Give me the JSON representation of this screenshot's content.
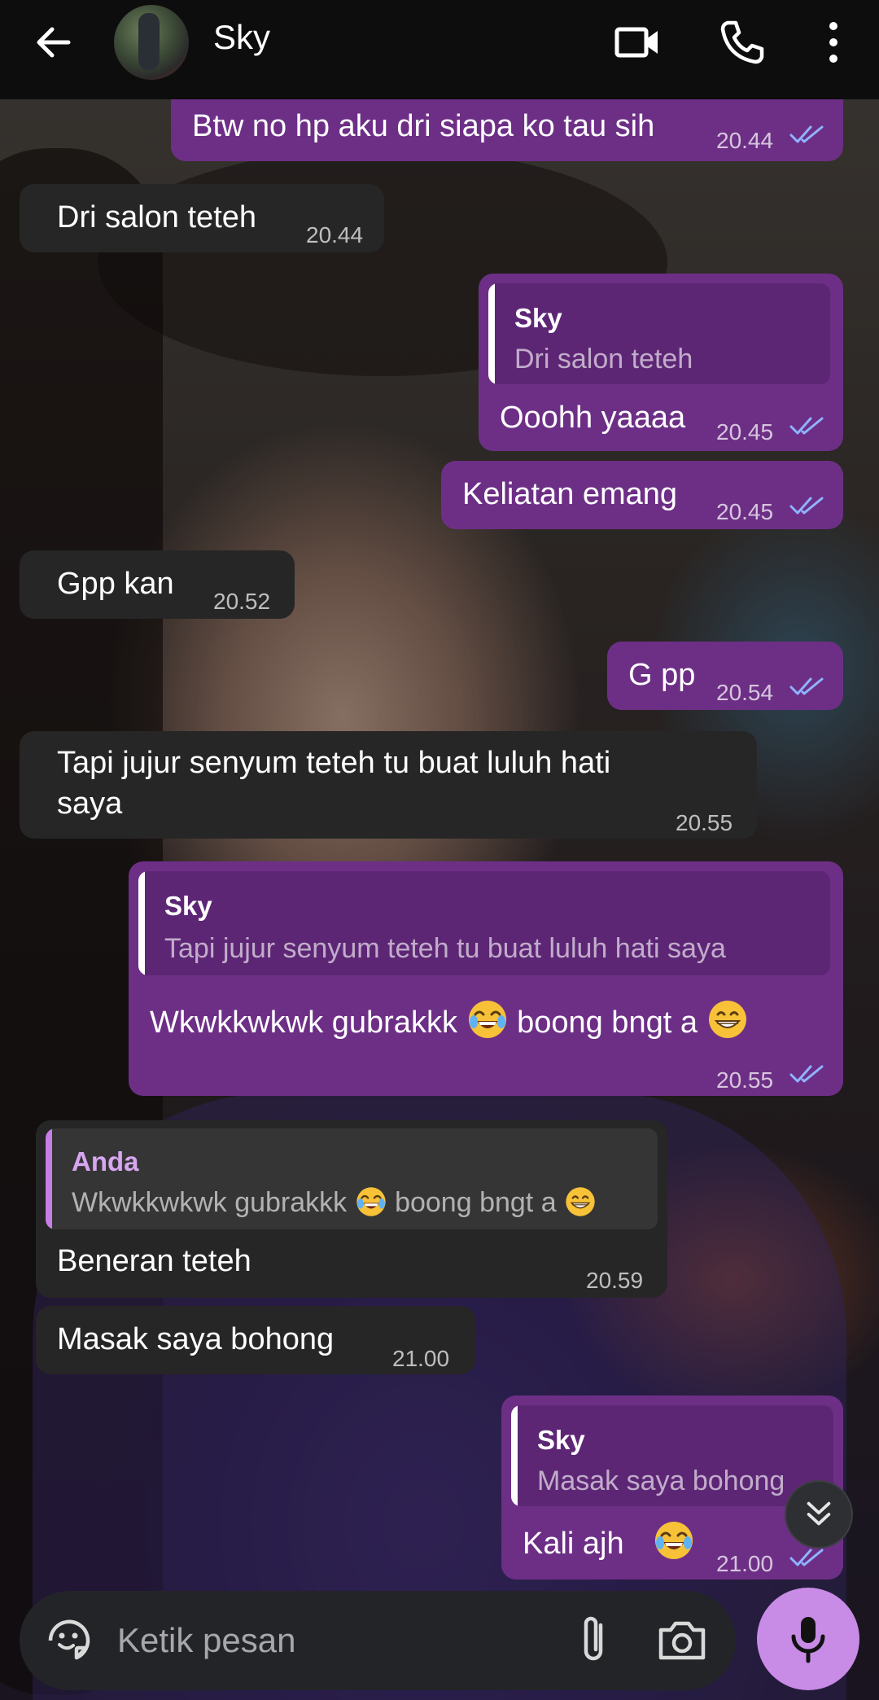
{
  "header": {
    "contact_name": "Sky",
    "icons": [
      "back-arrow-icon",
      "video-call-icon",
      "phone-icon",
      "more-vert-icon"
    ]
  },
  "colors": {
    "outgoing_bubble": "#6d2f86",
    "incoming_bubble": "#262626",
    "mic_button": "#c88be6",
    "read_ticks": "#8fb4ff",
    "reply_bar_incoming": "#c77ee6"
  },
  "messages": [
    {
      "direction": "out",
      "text": "Btw no hp aku dri siapa ko tau sih",
      "time": "20.44",
      "status": "read"
    },
    {
      "direction": "in",
      "text": "Dri salon teteh",
      "time": "20.44"
    },
    {
      "direction": "out",
      "reply_sender": "Sky",
      "reply_text": "Dri salon teteh",
      "text": "Ooohh yaaaa",
      "time": "20.45",
      "status": "read"
    },
    {
      "direction": "out",
      "text": "Keliatan emang",
      "time": "20.45",
      "status": "read"
    },
    {
      "direction": "in",
      "text": "Gpp kan",
      "time": "20.52"
    },
    {
      "direction": "out",
      "text": "G pp",
      "time": "20.54",
      "status": "read"
    },
    {
      "direction": "in",
      "text_line1": "Tapi jujur senyum teteh tu buat luluh hati",
      "text_line2": "saya",
      "time": "20.55"
    },
    {
      "direction": "out",
      "reply_sender": "Sky",
      "reply_text": "Tapi jujur senyum teteh tu buat luluh hati saya",
      "text_a": "Wkwkkwkwk gubrakkk",
      "text_b": "boong bngt a",
      "time": "20.55",
      "status": "read"
    },
    {
      "direction": "in",
      "reply_sender": "Anda",
      "reply_text_a": "Wkwkkwkwk gubrakkk",
      "reply_text_b": "boong bngt a",
      "text": "Beneran teteh",
      "time": "20.59"
    },
    {
      "direction": "in",
      "text": "Masak saya bohong",
      "time": "21.00"
    },
    {
      "direction": "out",
      "reply_sender": "Sky",
      "reply_text": "Masak saya bohong",
      "text": "Kali ajh",
      "time": "21.00",
      "status": "read"
    }
  ],
  "composer": {
    "placeholder": "Ketik pesan",
    "icons": [
      "sticker-icon",
      "attach-icon",
      "camera-icon",
      "mic-icon",
      "scroll-down-icon"
    ]
  }
}
